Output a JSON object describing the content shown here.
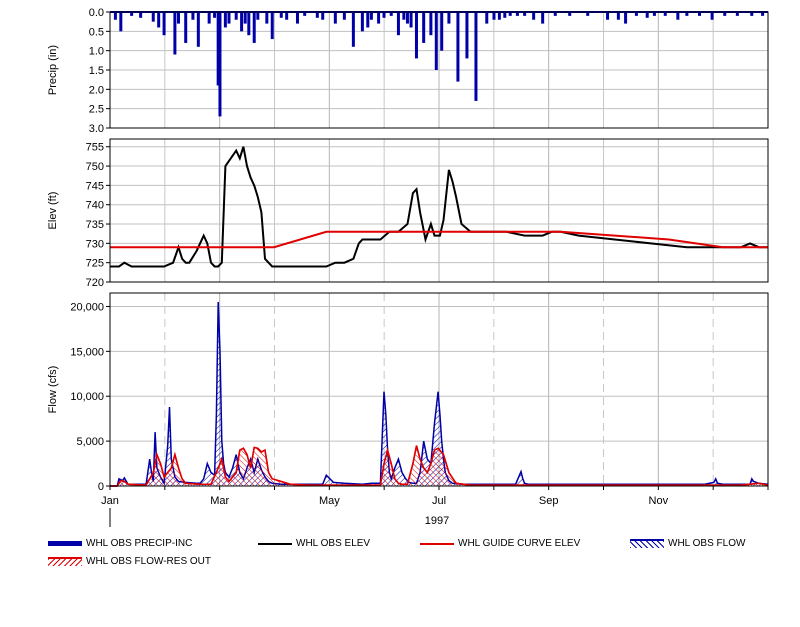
{
  "chart_data": {
    "type": "multi-panel-timeseries",
    "year_label": "1997",
    "x_tick_labels": [
      "Jan",
      "Mar",
      "May",
      "Jul",
      "Sep",
      "Nov"
    ],
    "x_ticks_month": [
      0,
      2,
      4,
      6,
      8,
      10
    ],
    "x_range_months": [
      0,
      12
    ],
    "panels": [
      {
        "id": "precip",
        "ylabel": "Precip (in)",
        "ylim": [
          0,
          3.0
        ],
        "y_inverted": true,
        "y_tick_labels": [
          "0.0",
          "0.5",
          "1.0",
          "1.5",
          "2.0",
          "2.5",
          "3.0"
        ],
        "y_ticks": [
          0,
          0.5,
          1.0,
          1.5,
          2.0,
          2.5,
          3.0
        ],
        "series": [
          {
            "name": "WHL OBS PRECIP-INC",
            "type": "bar",
            "color": "#0000a8",
            "x_day": [
              3,
              6,
              12,
              17,
              24,
              27,
              30,
              36,
              38,
              42,
              46,
              49,
              55,
              58,
              60,
              61,
              64,
              66,
              70,
              73,
              75,
              77,
              80,
              82,
              87,
              90,
              95,
              98,
              104,
              108,
              115,
              118,
              125,
              130,
              135,
              140,
              143,
              145,
              149,
              152,
              156,
              160,
              163,
              165,
              167,
              170,
              174,
              178,
              181,
              184,
              188,
              193,
              198,
              203,
              209,
              213,
              216,
              219,
              222,
              226,
              230,
              235,
              240,
              247,
              255,
              265,
              276,
              282,
              286,
              292,
              298,
              302,
              308,
              315,
              320,
              327,
              334,
              341,
              348,
              356,
              362
            ],
            "values": [
              0.2,
              0.5,
              0.1,
              0.15,
              0.25,
              0.4,
              0.6,
              1.1,
              0.3,
              0.8,
              0.2,
              0.9,
              0.3,
              0.15,
              1.9,
              2.7,
              0.4,
              0.3,
              0.2,
              0.5,
              0.3,
              0.6,
              0.8,
              0.2,
              0.3,
              0.7,
              0.15,
              0.2,
              0.3,
              0.1,
              0.15,
              0.2,
              0.3,
              0.2,
              0.9,
              0.5,
              0.4,
              0.2,
              0.3,
              0.15,
              0.1,
              0.6,
              0.2,
              0.3,
              0.4,
              1.2,
              0.8,
              0.6,
              1.5,
              1.0,
              0.3,
              1.8,
              1.2,
              2.3,
              0.3,
              0.2,
              0.2,
              0.15,
              0.1,
              0.1,
              0.1,
              0.2,
              0.3,
              0.1,
              0.1,
              0.1,
              0.2,
              0.2,
              0.3,
              0.1,
              0.15,
              0.1,
              0.1,
              0.2,
              0.1,
              0.1,
              0.2,
              0.1,
              0.1,
              0.1,
              0.1
            ]
          }
        ]
      },
      {
        "id": "elev",
        "ylabel": "Elev (ft)",
        "ylim": [
          720,
          757
        ],
        "y_tick_labels": [
          "720",
          "725",
          "730",
          "735",
          "740",
          "745",
          "750",
          "755"
        ],
        "y_ticks": [
          720,
          725,
          730,
          735,
          740,
          745,
          750,
          755
        ],
        "series": [
          {
            "name": "WHL OBS ELEV",
            "type": "line",
            "color": "#000000",
            "x_day": [
              0,
              5,
              8,
              12,
              30,
              35,
              38,
              40,
              42,
              44,
              48,
              52,
              54,
              56,
              58,
              60,
              62,
              64,
              70,
              72,
              74,
              76,
              78,
              80,
              82,
              84,
              86,
              88,
              90,
              92,
              95,
              100,
              120,
              125,
              130,
              135,
              138,
              140,
              145,
              150,
              155,
              160,
              165,
              168,
              170,
              172,
              175,
              178,
              180,
              183,
              185,
              188,
              190,
              192,
              195,
              200,
              210,
              220,
              230,
              240,
              245,
              250,
              260,
              280,
              300,
              320,
              340,
              345,
              350,
              355,
              360,
              365
            ],
            "values": [
              724,
              724,
              725,
              724,
              724,
              725,
              729,
              726,
              725,
              725,
              728,
              732,
              730,
              725,
              724,
              724,
              725,
              750,
              754,
              752,
              755,
              750,
              747,
              745,
              742,
              738,
              726,
              725,
              724,
              724,
              724,
              724,
              724,
              725,
              725,
              726,
              730,
              731,
              731,
              731,
              733,
              733,
              735,
              743,
              744,
              738,
              731,
              735,
              732,
              732,
              736,
              749,
              746,
              742,
              735,
              733,
              733,
              733,
              732,
              732,
              733,
              733,
              732,
              731,
              730,
              729,
              729,
              729,
              729,
              730,
              729,
              729
            ]
          },
          {
            "name": "WHL GUIDE CURVE ELEV",
            "type": "line",
            "color": "#e00000",
            "x_day": [
              0,
              91,
              120,
              151,
              234,
              250,
              280,
              310,
              340,
              365
            ],
            "values": [
              729,
              729,
              733,
              733,
              733,
              733,
              732,
              731,
              729,
              729
            ]
          }
        ]
      },
      {
        "id": "flow",
        "ylabel": "Flow (cfs)",
        "ylim": [
          0,
          21500
        ],
        "y_tick_labels": [
          "0",
          "5,000",
          "10,000",
          "15,000",
          "20,000"
        ],
        "y_ticks": [
          0,
          5000,
          10000,
          15000,
          20000
        ],
        "series": [
          {
            "name": "WHL OBS FLOW",
            "type": "hatched-area",
            "color": "#0000a8",
            "x_day": [
              0,
              4,
              5,
              7,
              8,
              10,
              20,
              22,
              23,
              24,
              25,
              26,
              28,
              30,
              32,
              33,
              34,
              35,
              36,
              38,
              42,
              48,
              50,
              52,
              54,
              56,
              58,
              59,
              60,
              61,
              62,
              63,
              64,
              66,
              68,
              70,
              72,
              74,
              76,
              78,
              80,
              82,
              84,
              86,
              88,
              90,
              95,
              100,
              110,
              118,
              120,
              122,
              124,
              130,
              140,
              145,
              150,
              152,
              153,
              154,
              155,
              156,
              158,
              160,
              162,
              164,
              166,
              168,
              170,
              172,
              174,
              176,
              178,
              180,
              182,
              183,
              184,
              185,
              186,
              188,
              190,
              195,
              200,
              210,
              225,
              228,
              229,
              230,
              232,
              240,
              260,
              300,
              330,
              335,
              336,
              337,
              340,
              350,
              355,
              356,
              357,
              360,
              365
            ],
            "values": [
              0,
              0,
              800,
              600,
              900,
              200,
              200,
              3000,
              1500,
              500,
              6000,
              2000,
              1000,
              300,
              4500,
              8800,
              3000,
              2000,
              1000,
              500,
              400,
              300,
              300,
              800,
              2500,
              1500,
              1200,
              8000,
              20500,
              15000,
              5000,
              2500,
              1500,
              1000,
              2000,
              3500,
              1500,
              800,
              2000,
              3000,
              1500,
              3000,
              1800,
              1000,
              500,
              300,
              200,
              200,
              200,
              200,
              1200,
              800,
              400,
              300,
              200,
              300,
              300,
              10500,
              8000,
              4000,
              1500,
              800,
              2000,
              3000,
              1500,
              800,
              400,
              300,
              300,
              1500,
              5000,
              3000,
              2500,
              7000,
              10500,
              8000,
              5000,
              3000,
              1500,
              600,
              300,
              200,
              200,
              200,
              200,
              1600,
              800,
              300,
              200,
              200,
              200,
              200,
              200,
              400,
              800,
              300,
              200,
              200,
              200,
              800,
              500,
              300,
              200
            ]
          },
          {
            "name": "WHL OBS FLOW-RES OUT",
            "type": "hatched-area",
            "color": "#e00000",
            "x_day": [
              0,
              4,
              6,
              8,
              10,
              20,
              24,
              26,
              28,
              30,
              34,
              36,
              38,
              40,
              42,
              50,
              56,
              60,
              62,
              64,
              66,
              70,
              72,
              74,
              76,
              78,
              80,
              82,
              84,
              86,
              88,
              90,
              95,
              100,
              110,
              140,
              150,
              152,
              154,
              156,
              158,
              160,
              162,
              165,
              168,
              170,
              172,
              174,
              176,
              178,
              180,
              182,
              185,
              188,
              192,
              200,
              230,
              280,
              320,
              350,
              360,
              365
            ],
            "values": [
              0,
              0,
              600,
              500,
              200,
              100,
              1500,
              3500,
              2500,
              1000,
              2000,
              3500,
              2000,
              800,
              300,
              200,
              200,
              2000,
              3000,
              1000,
              500,
              1500,
              4000,
              4200,
              3500,
              2000,
              4300,
              4200,
              3800,
              4000,
              1500,
              800,
              500,
              200,
              100,
              100,
              100,
              2500,
              4000,
              2500,
              800,
              300,
              200,
              200,
              2500,
              4500,
              3000,
              2000,
              1500,
              2500,
              4000,
              4200,
              3500,
              1500,
              300,
              100,
              100,
              100,
              100,
              100,
              300,
              100
            ]
          },
          {
            "name": "WHL OBS FLOW-RES OUT",
            "type": "line",
            "color": "#e00000",
            "x_day": [
              0,
              4,
              6,
              8,
              10,
              20,
              24,
              26,
              28,
              30,
              34,
              36,
              38,
              40,
              42,
              50,
              56,
              60,
              62,
              64,
              66,
              70,
              72,
              74,
              76,
              78,
              80,
              82,
              84,
              86,
              88,
              90,
              95,
              100,
              110,
              140,
              150,
              152,
              154,
              156,
              158,
              160,
              162,
              165,
              168,
              170,
              172,
              174,
              176,
              178,
              180,
              182,
              185,
              188,
              192,
              200,
              230,
              280,
              320,
              350,
              360,
              365
            ],
            "values": [
              0,
              0,
              600,
              500,
              200,
              100,
              1500,
              3500,
              2500,
              1000,
              2000,
              3500,
              2000,
              800,
              300,
              200,
              200,
              2000,
              3000,
              1000,
              500,
              1500,
              4000,
              4200,
              3500,
              2000,
              4300,
              4200,
              3800,
              4000,
              1500,
              800,
              500,
              200,
              100,
              100,
              100,
              2500,
              4000,
              2500,
              800,
              300,
              200,
              200,
              2500,
              4500,
              3000,
              2000,
              1500,
              2500,
              4000,
              4200,
              3500,
              1500,
              300,
              100,
              100,
              100,
              100,
              100,
              300,
              100
            ]
          }
        ]
      }
    ],
    "legend": [
      {
        "label": "WHL OBS PRECIP-INC",
        "style": "thick",
        "color": "#0000a8"
      },
      {
        "label": "WHL OBS ELEV",
        "style": "line",
        "color": "#000000"
      },
      {
        "label": "WHL GUIDE CURVE ELEV",
        "style": "line",
        "color": "#e00000"
      },
      {
        "label": "WHL OBS FLOW",
        "style": "hatch",
        "color": "#0000a8"
      },
      {
        "label": "WHL OBS FLOW-RES OUT",
        "style": "hatch",
        "color": "#e00000"
      }
    ]
  }
}
